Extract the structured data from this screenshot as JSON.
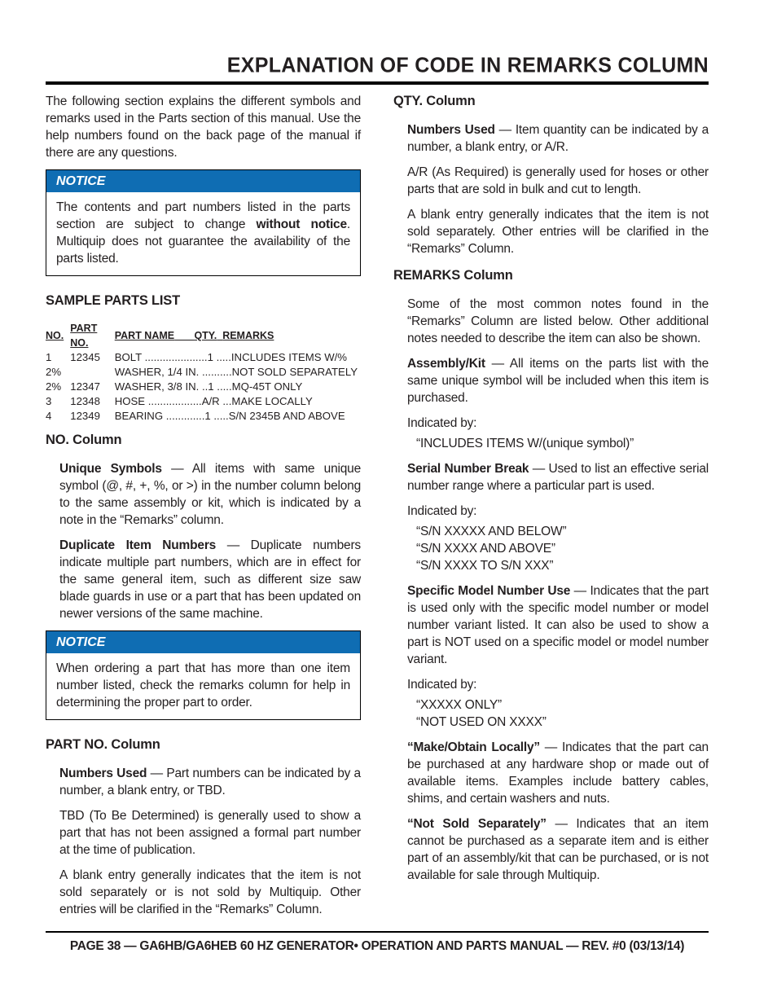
{
  "title": "EXPLANATION OF CODE IN REMARKS COLUMN",
  "left": {
    "intro": "The following section explains the different symbols and remarks used in the Parts section of this manual. Use the help numbers found on the back page of the manual if there are any questions.",
    "notice1": {
      "label": "NOTICE",
      "text_a": "The contents and part numbers listed in the parts section are subject to change ",
      "text_bold": "without notice",
      "text_b": ". Multiquip does not guarantee the availability of the parts listed."
    },
    "sample_heading": "SAMPLE PARTS LIST",
    "sample_table": {
      "headers": [
        "NO.",
        "PART NO.",
        "PART NAME",
        "QTY.",
        "REMARKS"
      ],
      "rows": [
        [
          "1",
          "12345",
          "BOLT .....................1 .....INCLUDES ITEMS W/%"
        ],
        [
          "2%",
          "",
          "WASHER, 1/4 IN. ..........NOT SOLD SEPARATELY"
        ],
        [
          "2%",
          "12347",
          "WASHER, 3/8 IN. ..1 .....MQ-45T ONLY"
        ],
        [
          "3",
          "12348",
          "HOSE ..................A/R ...MAKE LOCALLY"
        ],
        [
          "4",
          "12349",
          "BEARING .............1 .....S/N 2345B AND ABOVE"
        ]
      ]
    },
    "no_heading": "NO. Column",
    "unique_label": "Unique Symbols",
    "unique_text": " — All items with same unique symbol (@, #, +, %, or >) in the number column belong to the same assembly or kit, which is indicated by a note in the “Remarks” column.",
    "dup_label": "Duplicate Item Numbers",
    "dup_text": " — Duplicate numbers indicate multiple part numbers, which are in effect for the same general item, such as different size saw blade guards in use or a part that has been updated on newer versions of the same machine.",
    "notice2": {
      "label": "NOTICE",
      "text": "When ordering a part that has more than one item number listed, check the remarks column for help in determining the proper part to order."
    },
    "partno_heading": "PART NO. Column",
    "partno_used_label": "Numbers Used",
    "partno_used_text": " — Part numbers can be indicated by a number, a blank entry, or TBD.",
    "tbd_text": "TBD (To Be Determined) is generally used to show a part that has not been assigned a formal part number at the time of publication.",
    "blank_text": "A blank entry generally indicates that the item is not sold separately or is not sold by Multiquip. Other entries will be clarified in the “Remarks” Column."
  },
  "right": {
    "qty_heading": "QTY. Column",
    "qty_used_label": "Numbers Used",
    "qty_used_text": " — Item quantity can be indicated by a number, a blank entry, or A/R.",
    "ar_text": "A/R (As Required) is generally used for hoses or other parts that are sold in bulk and cut to length.",
    "blank_text": "A blank entry generally indicates that the item is not sold separately. Other entries will be clarified in the “Remarks” Column.",
    "remarks_heading": "REMARKS Column",
    "remarks_intro": "Some of the most common notes found in the “Remarks” Column are listed below. Other additional notes needed to describe the item can also be shown.",
    "assembly_label": "Assembly/Kit",
    "assembly_text": " — All items on the parts list with the same unique symbol will be included when this item is purchased.",
    "indicated_by": "Indicated by:",
    "assembly_quotes": [
      "“INCLUDES ITEMS W/(unique symbol)”"
    ],
    "serial_label": "Serial Number Break",
    "serial_text": " — Used to list an effective serial number range where a particular part is used.",
    "serial_quotes": [
      "“S/N XXXXX AND BELOW”",
      "“S/N XXXX AND ABOVE”",
      "“S/N XXXX TO S/N XXX”"
    ],
    "model_label": "Specific Model Number Use",
    "model_text": " — Indicates that the part is used only with the specific model number or model number variant listed. It can also be used to show a part is NOT used on a specific model or model number variant.",
    "model_quotes": [
      "“XXXXX ONLY”",
      "“NOT USED ON XXXX”"
    ],
    "make_label": "“Make/Obtain Locally”",
    "make_text": " — Indicates that the part can be purchased at any hardware shop or made out of available items. Examples include battery cables, shims, and certain washers and nuts.",
    "nss_label": "“Not Sold Separately”",
    "nss_text": " — Indicates that an item cannot be purchased as a separate item and is either part of an assembly/kit that can be purchased, or is not available for sale through Multiquip."
  },
  "footer": "PAGE 38 — GA6HB/GA6HEB 60 HZ GENERATOR• OPERATION AND PARTS MANUAL — REV. #0 (03/13/14)"
}
